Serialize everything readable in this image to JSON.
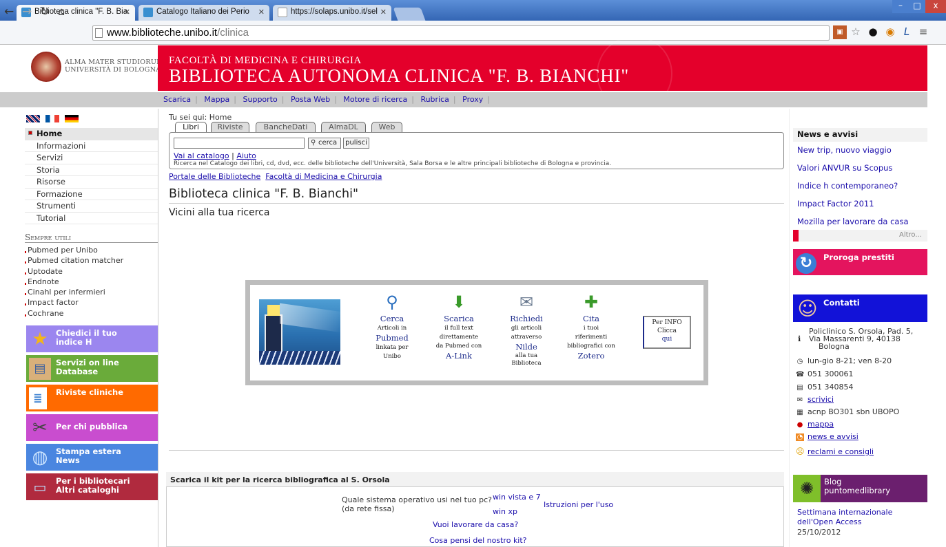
{
  "browser": {
    "tabs": [
      {
        "title": "Biblioteca clinica \"F. B. Bia"
      },
      {
        "title": "Catalogo Italiano dei Perio"
      },
      {
        "title": "https://solaps.unibo.it/sel"
      }
    ],
    "url_domain": "www.biblioteche.unibo.it",
    "url_path": "/clinica",
    "window_buttons": [
      "–",
      "□",
      "x"
    ]
  },
  "header": {
    "university_line1": "ALMA MATER STUDIORUM",
    "university_line2": "UNIVERSITÀ DI BOLOGNA",
    "faculty": "FACOLTÀ DI MEDICINA E CHIRURGIA",
    "library": "BIBLIOTECA AUTONOMA CLINICA \"F. B. BIANCHI\"",
    "banner_color": "#e4002b"
  },
  "toplinks": [
    "Scarica",
    "Mappa",
    "Supporto",
    "Posta Web",
    "Motore di ricerca",
    "Rubrica",
    "Proxy"
  ],
  "left_nav": {
    "items": [
      "Home",
      "Informazioni",
      "Servizi",
      "Storia",
      "Risorse",
      "Formazione",
      "Strumenti",
      "Tutorial"
    ],
    "sempre_title": "Sempre utili",
    "utili": [
      "Pubmed per Unibo",
      "Pubmed citation matcher",
      "Uptodate",
      "Endnote",
      "Cinahl per infermieri",
      "Impact factor",
      "Cochrane"
    ],
    "boxes": [
      {
        "line1": "Chiedici il tuo",
        "line2": "indice H",
        "color": "#9b86ef"
      },
      {
        "line1": "Servizi on line",
        "line2": "Database",
        "color": "#6aab3a"
      },
      {
        "line1": "Riviste cliniche",
        "line2": "",
        "color": "#ff6a00"
      },
      {
        "line1": "Per chi pubblica",
        "line2": "",
        "color": "#c94dcf"
      },
      {
        "line1": "Stampa estera",
        "line2": "News",
        "color": "#4a86e0"
      },
      {
        "line1": "Per i bibliotecari",
        "line2": "Altri cataloghi",
        "color": "#b02a3e"
      }
    ]
  },
  "main": {
    "breadcrumb": "Tu sei qui: Home",
    "search_tabs": [
      "Libri",
      "Riviste",
      "BancheDati",
      "AlmaDL",
      "Web"
    ],
    "search_button": "cerca",
    "clear_button": "pulisci",
    "catalog_link": "Vai al catalogo",
    "help_link": "Aiuto",
    "search_desc": "Ricerca nel Catalogo dei libri, cd, dvd, ecc. delle biblioteche dell'Università, Sala Borsa e le altre principali biblioteche di Bologna e provincia.",
    "portal_link": "Portale delle Biblioteche",
    "faculty_link": "Facoltà di Medicina e Chirurgia",
    "title": "Biblioteca clinica \"F. B. Bianchi\"",
    "subtitle": "Vicini alla tua ricerca",
    "banner_cols": [
      {
        "t1": "Cerca",
        "t2": "Articoli in",
        "t3": "Pubmed",
        "t4": "linkata per",
        "t5": "Unibo"
      },
      {
        "t1": "Scarica",
        "t2": "il full text",
        "t3": "direttamente",
        "t4": "da Pubmed con",
        "t5": "A-Link"
      },
      {
        "t1": "Richiedi",
        "t2": "gli articoli",
        "t3": "attraverso",
        "t4": "Nilde",
        "t5": "alla tua Biblioteca"
      },
      {
        "t1": "Cita",
        "t2": "i tuoi",
        "t3": "riferimenti",
        "t4": "bibliografici con",
        "t5": "Zotero"
      }
    ],
    "per_info": "Per INFO",
    "clicca": "Clicca",
    "qui": "qui",
    "kit_title": "Scarica il kit per la ricerca bibliografica al S. Orsola",
    "kit_question": "Quale sistema operativo usi nel tuo pc?",
    "kit_note": "(da rete fissa)",
    "win_vista": "win vista e 7",
    "win_xp": "win xp",
    "istruzioni": "Istruzioni per l'uso",
    "casa": "Vuoi lavorare da casa?",
    "pensi": "Cosa pensi del nostro kit?"
  },
  "right": {
    "news_title": "News e avvisi",
    "news": [
      "New trip, nuovo viaggio",
      "Valori ANVUR su Scopus",
      "Indice h contemporaneo?",
      "Impact Factor 2011",
      "Mozilla per lavorare da casa"
    ],
    "altro": "Altro...",
    "proroga": "Proroga prestiti",
    "contatti": "Contatti",
    "address1": "Policlinico S. Orsola, Pad. 5,",
    "address2": "Via Massarenti 9, 40138",
    "address3": "Bologna",
    "hours": "lun-gio 8-21; ven 8-20",
    "phone": "051 300061",
    "fax": "051 340854",
    "scrivici": "scrivici",
    "acnp": "acnp BO301 sbn UBOPO",
    "mappa": "mappa",
    "news_avvisi": "news e avvisi",
    "reclami": "reclami e consigli",
    "blog1": "Blog",
    "blog2": "puntomedlibrary",
    "blog_post1": "Settimana internazionale",
    "blog_post2": "dell'Open Access",
    "blog_date": "25/10/2012"
  }
}
